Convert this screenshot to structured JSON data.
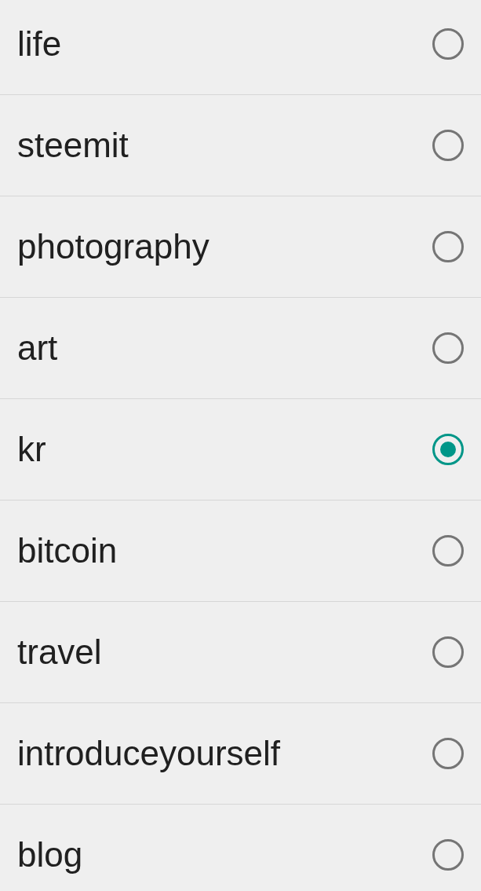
{
  "options": [
    {
      "label": "life",
      "selected": false
    },
    {
      "label": "steemit",
      "selected": false
    },
    {
      "label": "photography",
      "selected": false
    },
    {
      "label": "art",
      "selected": false
    },
    {
      "label": "kr",
      "selected": true
    },
    {
      "label": "bitcoin",
      "selected": false
    },
    {
      "label": "travel",
      "selected": false
    },
    {
      "label": "introduceyourself",
      "selected": false
    },
    {
      "label": "blog",
      "selected": false
    }
  ]
}
